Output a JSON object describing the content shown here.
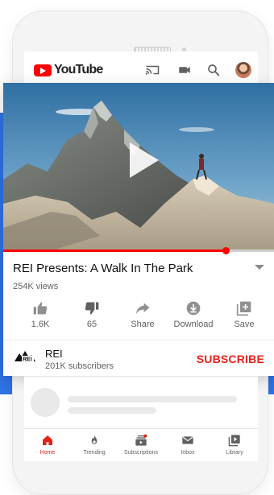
{
  "header": {
    "logo_text": "YouTube",
    "icons": [
      "cast-icon",
      "camera-icon",
      "search-icon",
      "account-avatar"
    ]
  },
  "video": {
    "title": "REI Presents: A Walk In The Park",
    "views": "254K views",
    "progress_fraction": 0.82
  },
  "actions": [
    {
      "name": "like",
      "label": "1.6K",
      "icon": "thumbs-up-icon"
    },
    {
      "name": "dislike",
      "label": "65",
      "icon": "thumbs-down-icon"
    },
    {
      "name": "share",
      "label": "Share",
      "icon": "share-icon"
    },
    {
      "name": "download",
      "label": "Download",
      "icon": "download-icon"
    },
    {
      "name": "save",
      "label": "Save",
      "icon": "add-to-playlist-icon"
    }
  ],
  "channel": {
    "name": "REI",
    "subscribers": "201K subscribers",
    "subscribe_label": "SUBSCRIBE",
    "logo_text": "REI"
  },
  "bottom_nav": [
    {
      "label": "Home",
      "icon": "home-icon",
      "active": true
    },
    {
      "label": "Trending",
      "icon": "flame-icon",
      "active": false
    },
    {
      "label": "Subscriptions",
      "icon": "subscriptions-icon",
      "active": false
    },
    {
      "label": "Inbox",
      "icon": "mail-icon",
      "active": false
    },
    {
      "label": "Library",
      "icon": "library-icon",
      "active": false
    }
  ],
  "colors": {
    "accent_red": "#ff0000",
    "subscribe_red": "#e62117",
    "band_blue": "#2f73e6"
  }
}
